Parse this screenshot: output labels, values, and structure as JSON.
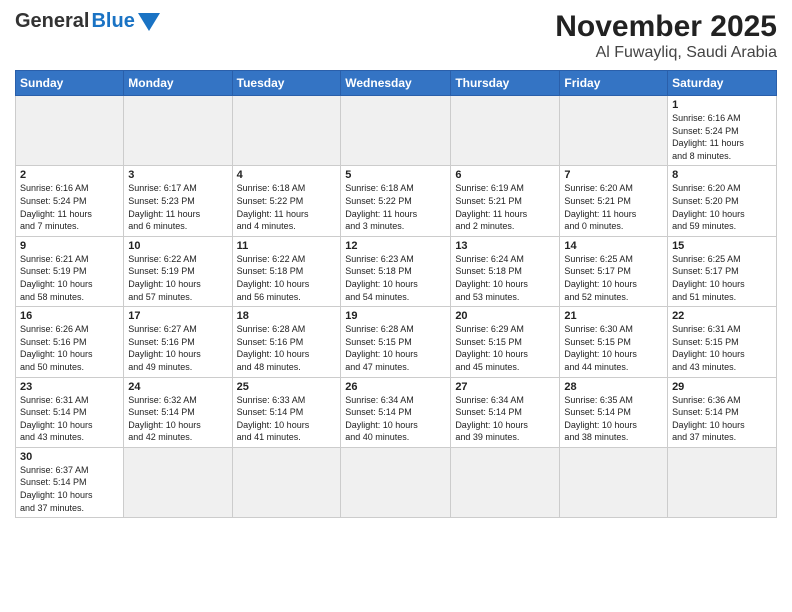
{
  "header": {
    "logo_general": "General",
    "logo_blue": "Blue",
    "title": "November 2025",
    "subtitle": "Al Fuwayliq, Saudi Arabia"
  },
  "weekdays": [
    "Sunday",
    "Monday",
    "Tuesday",
    "Wednesday",
    "Thursday",
    "Friday",
    "Saturday"
  ],
  "weeks": [
    [
      {
        "day": "",
        "info": ""
      },
      {
        "day": "",
        "info": ""
      },
      {
        "day": "",
        "info": ""
      },
      {
        "day": "",
        "info": ""
      },
      {
        "day": "",
        "info": ""
      },
      {
        "day": "",
        "info": ""
      },
      {
        "day": "1",
        "info": "Sunrise: 6:16 AM\nSunset: 5:24 PM\nDaylight: 11 hours\nand 8 minutes."
      }
    ],
    [
      {
        "day": "2",
        "info": "Sunrise: 6:16 AM\nSunset: 5:24 PM\nDaylight: 11 hours\nand 7 minutes."
      },
      {
        "day": "3",
        "info": "Sunrise: 6:17 AM\nSunset: 5:23 PM\nDaylight: 11 hours\nand 6 minutes."
      },
      {
        "day": "4",
        "info": "Sunrise: 6:18 AM\nSunset: 5:22 PM\nDaylight: 11 hours\nand 4 minutes."
      },
      {
        "day": "5",
        "info": "Sunrise: 6:18 AM\nSunset: 5:22 PM\nDaylight: 11 hours\nand 3 minutes."
      },
      {
        "day": "6",
        "info": "Sunrise: 6:19 AM\nSunset: 5:21 PM\nDaylight: 11 hours\nand 2 minutes."
      },
      {
        "day": "7",
        "info": "Sunrise: 6:20 AM\nSunset: 5:21 PM\nDaylight: 11 hours\nand 0 minutes."
      },
      {
        "day": "8",
        "info": "Sunrise: 6:20 AM\nSunset: 5:20 PM\nDaylight: 10 hours\nand 59 minutes."
      }
    ],
    [
      {
        "day": "9",
        "info": "Sunrise: 6:21 AM\nSunset: 5:19 PM\nDaylight: 10 hours\nand 58 minutes."
      },
      {
        "day": "10",
        "info": "Sunrise: 6:22 AM\nSunset: 5:19 PM\nDaylight: 10 hours\nand 57 minutes."
      },
      {
        "day": "11",
        "info": "Sunrise: 6:22 AM\nSunset: 5:18 PM\nDaylight: 10 hours\nand 56 minutes."
      },
      {
        "day": "12",
        "info": "Sunrise: 6:23 AM\nSunset: 5:18 PM\nDaylight: 10 hours\nand 54 minutes."
      },
      {
        "day": "13",
        "info": "Sunrise: 6:24 AM\nSunset: 5:18 PM\nDaylight: 10 hours\nand 53 minutes."
      },
      {
        "day": "14",
        "info": "Sunrise: 6:25 AM\nSunset: 5:17 PM\nDaylight: 10 hours\nand 52 minutes."
      },
      {
        "day": "15",
        "info": "Sunrise: 6:25 AM\nSunset: 5:17 PM\nDaylight: 10 hours\nand 51 minutes."
      }
    ],
    [
      {
        "day": "16",
        "info": "Sunrise: 6:26 AM\nSunset: 5:16 PM\nDaylight: 10 hours\nand 50 minutes."
      },
      {
        "day": "17",
        "info": "Sunrise: 6:27 AM\nSunset: 5:16 PM\nDaylight: 10 hours\nand 49 minutes."
      },
      {
        "day": "18",
        "info": "Sunrise: 6:28 AM\nSunset: 5:16 PM\nDaylight: 10 hours\nand 48 minutes."
      },
      {
        "day": "19",
        "info": "Sunrise: 6:28 AM\nSunset: 5:15 PM\nDaylight: 10 hours\nand 47 minutes."
      },
      {
        "day": "20",
        "info": "Sunrise: 6:29 AM\nSunset: 5:15 PM\nDaylight: 10 hours\nand 45 minutes."
      },
      {
        "day": "21",
        "info": "Sunrise: 6:30 AM\nSunset: 5:15 PM\nDaylight: 10 hours\nand 44 minutes."
      },
      {
        "day": "22",
        "info": "Sunrise: 6:31 AM\nSunset: 5:15 PM\nDaylight: 10 hours\nand 43 minutes."
      }
    ],
    [
      {
        "day": "23",
        "info": "Sunrise: 6:31 AM\nSunset: 5:14 PM\nDaylight: 10 hours\nand 43 minutes."
      },
      {
        "day": "24",
        "info": "Sunrise: 6:32 AM\nSunset: 5:14 PM\nDaylight: 10 hours\nand 42 minutes."
      },
      {
        "day": "25",
        "info": "Sunrise: 6:33 AM\nSunset: 5:14 PM\nDaylight: 10 hours\nand 41 minutes."
      },
      {
        "day": "26",
        "info": "Sunrise: 6:34 AM\nSunset: 5:14 PM\nDaylight: 10 hours\nand 40 minutes."
      },
      {
        "day": "27",
        "info": "Sunrise: 6:34 AM\nSunset: 5:14 PM\nDaylight: 10 hours\nand 39 minutes."
      },
      {
        "day": "28",
        "info": "Sunrise: 6:35 AM\nSunset: 5:14 PM\nDaylight: 10 hours\nand 38 minutes."
      },
      {
        "day": "29",
        "info": "Sunrise: 6:36 AM\nSunset: 5:14 PM\nDaylight: 10 hours\nand 37 minutes."
      }
    ],
    [
      {
        "day": "30",
        "info": "Sunrise: 6:37 AM\nSunset: 5:14 PM\nDaylight: 10 hours\nand 37 minutes."
      },
      {
        "day": "",
        "info": ""
      },
      {
        "day": "",
        "info": ""
      },
      {
        "day": "",
        "info": ""
      },
      {
        "day": "",
        "info": ""
      },
      {
        "day": "",
        "info": ""
      },
      {
        "day": "",
        "info": ""
      }
    ]
  ]
}
